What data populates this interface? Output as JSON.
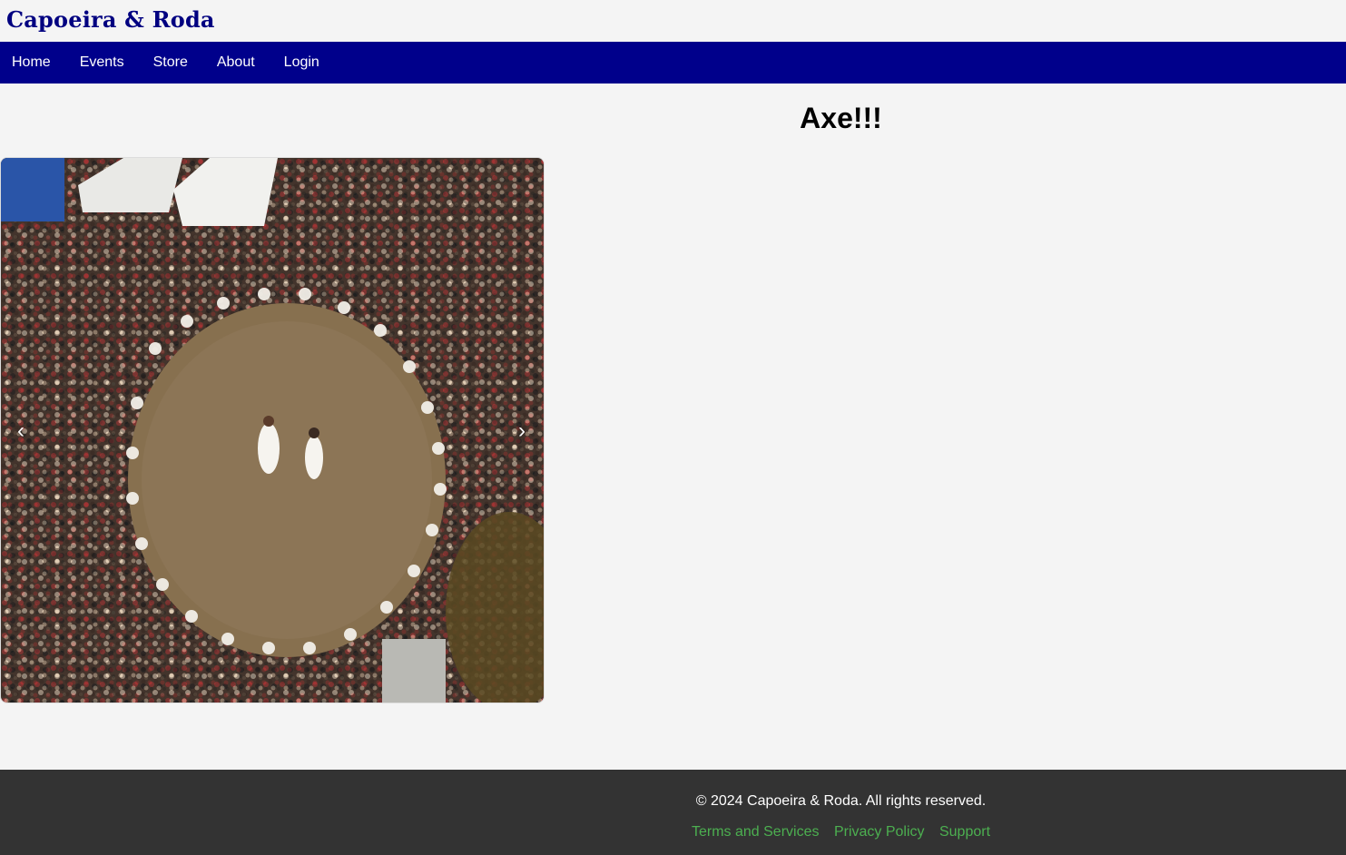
{
  "header": {
    "brand": "Capoeira & Roda"
  },
  "nav": {
    "items": [
      {
        "label": "Home"
      },
      {
        "label": "Events"
      },
      {
        "label": "Store"
      },
      {
        "label": "About"
      },
      {
        "label": "Login"
      }
    ]
  },
  "main": {
    "title": "Axe!!!",
    "carousel": {
      "prev_icon": "chevron-left-icon",
      "prev_glyph": "‹",
      "next_icon": "chevron-right-icon",
      "next_glyph": "›"
    }
  },
  "footer": {
    "copyright": "© 2024 Capoeira & Roda. All rights reserved.",
    "links": [
      {
        "label": "Terms and Services"
      },
      {
        "label": "Privacy Policy"
      },
      {
        "label": "Support"
      }
    ]
  },
  "colors": {
    "brand": "#000080",
    "nav_bg": "#00008b",
    "footer_bg": "#333333",
    "link_accent": "#4caf50",
    "page_bg": "#f4f4f4"
  }
}
